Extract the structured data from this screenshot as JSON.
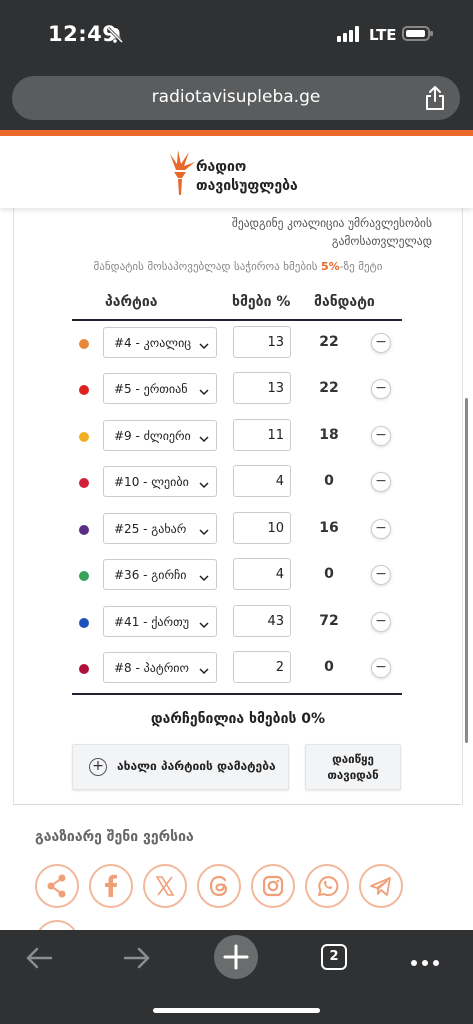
{
  "status": {
    "time": "12:49",
    "network": "LTE"
  },
  "browser": {
    "url": "radiotavisupleba.ge",
    "tab_count": "2"
  },
  "logo": {
    "line1": "რადიო",
    "line2": "თავისუფლება"
  },
  "calculator": {
    "note": "შეადგინე კოალიცია უმრავლესობის გამოსათვლელად",
    "threshold_prefix": "მანდატის მოსაპოვებლად საჭიროა ხმების ",
    "threshold_value": "5%",
    "threshold_suffix": "-ზე მეტი",
    "headers": {
      "party": "პარტია",
      "votes": "ხმები %",
      "mandates": "მანდატი"
    },
    "parties": [
      {
        "label": "#4 - კოალიც",
        "votes": "13",
        "mandates": "22",
        "color": "#e8873a"
      },
      {
        "label": "#5 - ერთიან",
        "votes": "13",
        "mandates": "22",
        "color": "#e02020"
      },
      {
        "label": "#9 - ძლიერი",
        "votes": "11",
        "mandates": "18",
        "color": "#f0b020"
      },
      {
        "label": "#10 - ლეიბი",
        "votes": "4",
        "mandates": "0",
        "color": "#d0203a"
      },
      {
        "label": "#25 - გახარ",
        "votes": "10",
        "mandates": "16",
        "color": "#5a2d82"
      },
      {
        "label": "#36 - გირჩი",
        "votes": "4",
        "mandates": "0",
        "color": "#3aa35a"
      },
      {
        "label": "#41 - ქართუ",
        "votes": "43",
        "mandates": "72",
        "color": "#1f4fb8"
      },
      {
        "label": "#8 - პატრიო",
        "votes": "2",
        "mandates": "0",
        "color": "#b0103a"
      }
    ],
    "minus_symbol": "−",
    "remaining": "დარჩენილია ხმების 0%",
    "add_party": "ახალი პარტიის დამატება",
    "reset_line1": "დაიწყე",
    "reset_line2": "თავიდან"
  },
  "share": {
    "title": "გააზიარე შენი ვერსია",
    "icons": [
      "share-icon",
      "facebook-icon",
      "x-icon",
      "threads-icon",
      "instagram-icon",
      "whatsapp-icon",
      "telegram-icon"
    ]
  },
  "colors": {
    "accent": "#e8692a",
    "social": "#f0a078",
    "chrome": "#2f3133"
  }
}
